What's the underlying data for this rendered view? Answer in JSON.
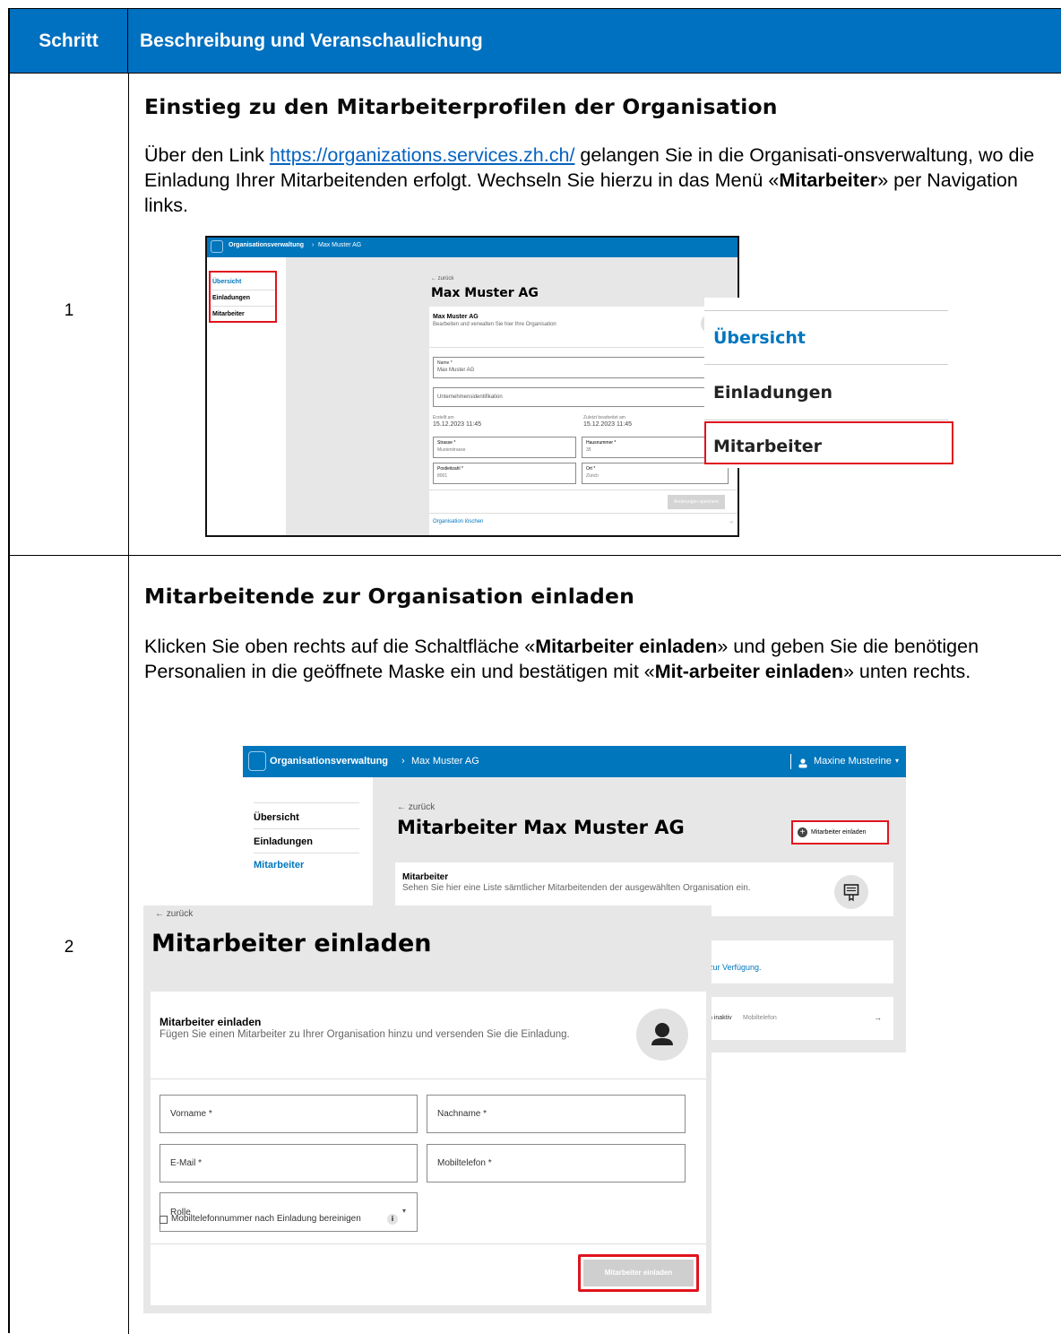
{
  "table": {
    "header": {
      "col_step": "Schritt",
      "col_desc": "Beschreibung und Veranschaulichung"
    },
    "rows": [
      {
        "step": "1",
        "title": "Einstieg zu den Mitarbeiterprofilen der Organisation",
        "text": {
          "part1": "Über den Link ",
          "link": "https://organizations.services.zh.ch/",
          "part2": " gelangen Sie in die Organisati-onsverwaltung, wo die Einladung Ihrer Mitarbeitenden erfolgt. Wechseln Sie hierzu in das Menü «",
          "bold1": "Mitarbeiter",
          "part3": "» per Navigation links."
        }
      },
      {
        "step": "2",
        "title": "Mitarbeitende zur Organisation einladen",
        "text": {
          "part1": "Klicken Sie oben rechts auf die Schaltfläche «",
          "bold1": "Mitarbeiter einladen",
          "part2": "» und geben Sie die benötigen Personalien in die geöffnete Maske ein und bestätigen mit «",
          "bold2": "Mit-arbeiter einladen",
          "part3": "» unten rechts."
        }
      }
    ]
  },
  "shot1": {
    "topbar_app": "Organisationsverwaltung",
    "topbar_sep": "›",
    "topbar_org": "Max Muster AG",
    "nav": [
      "Übersicht",
      "Einladungen",
      "Mitarbeiter"
    ],
    "back": "← zurück",
    "page_title": "Max Muster AG",
    "card_title": "Max Muster AG",
    "card_sub": "Bearbeiten und verwalten Sie hier Ihre Organisation",
    "name_label": "Name *",
    "name_value": "Max Muster AG",
    "uid_label": "Unternehmensidentifikation",
    "created_label": "Erstellt am",
    "created_value": "15.12.2023 11:45",
    "updated_label": "Zuletzt bearbeitet am",
    "updated_value": "15.12.2023 11:45",
    "street_label": "Strasse *",
    "street_value": "Musterstrasse",
    "number_label": "Hausnummer *",
    "number_value": "35",
    "zip_label": "Postleitzahl *",
    "zip_value": "8001",
    "city_label": "Ort *",
    "city_value": "Zürich",
    "save_button": "Änderungen speichern",
    "delete_link": "Organisation löschen",
    "zoom_nav": [
      "Übersicht",
      "Einladungen",
      "Mitarbeiter"
    ]
  },
  "shot2": {
    "topbar_app": "Organisationsverwaltung",
    "topbar_sep": "›",
    "topbar_org": "Max Muster AG",
    "user_name": "Maxine Musterine",
    "user_caret": "▾",
    "nav": [
      "Übersicht",
      "Einladungen",
      "Mitarbeiter"
    ],
    "back": "← zurück",
    "page_title": "Mitarbeiter Max Muster AG",
    "invite_button": "Mitarbeiter einladen",
    "card_title": "Mitarbeiter",
    "card_sub": "Sehen Sie hier eine Liste sämtlicher Mitarbeitenden der ausgewählten Organisation ein.",
    "partial_text": "zur Verfügung.",
    "partial_row": "n inaktiv",
    "partial_row2": "Mobiltelefon",
    "arrow": "→"
  },
  "dialog": {
    "back": "← zurück",
    "title": "Mitarbeiter einladen",
    "card_title": "Mitarbeiter einladen",
    "card_sub": "Fügen Sie einen Mitarbeiter zu Ihrer Organisation hinzu und versenden Sie die Einladung.",
    "first_name": "Vorname",
    "last_name": "Nachname",
    "email": "E-Mail",
    "mobile": "Mobiltelefon",
    "required": "*",
    "role": "Rolle",
    "role_caret": "▾",
    "checkbox_label": "Mobiltelefonnummer nach Einladung bereinigen",
    "info": "i",
    "submit": "Mitarbeiter einladen"
  },
  "colors": {
    "header_blue": "#0070c0",
    "app_blue": "#0076bd",
    "highlight_red": "#e0141e",
    "link": "#0563c1"
  }
}
